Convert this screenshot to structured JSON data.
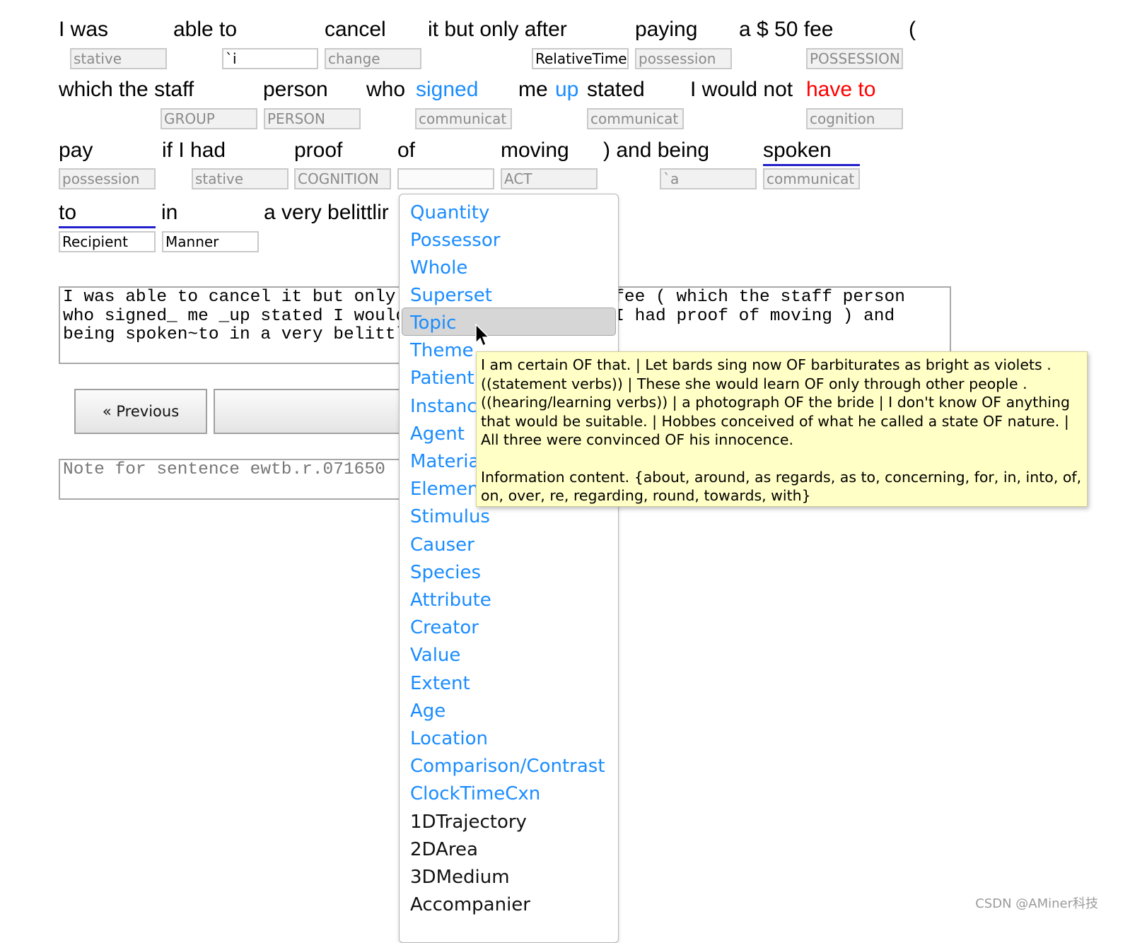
{
  "tokens": [
    {
      "text": "I was",
      "tag": "stative"
    },
    {
      "text": "able to",
      "tag": "`i"
    },
    {
      "text": "cancel",
      "tag": "change"
    },
    {
      "text": "it but only after",
      "tag": "RelativeTime"
    },
    {
      "text": "paying",
      "tag": "possession"
    },
    {
      "text": "a $ 50 fee",
      "tag": "POSSESSION"
    },
    {
      "text": "(",
      "tag": ""
    },
    {
      "text": "which the staff",
      "tag": ""
    },
    {
      "text": "person",
      "tag": "GROUP"
    },
    {
      "text": "",
      "tag": "PERSON"
    },
    {
      "text": "who",
      "tag": ""
    },
    {
      "text": "signed",
      "tag": "communicat"
    },
    {
      "text": "me",
      "tag": ""
    },
    {
      "text": "up",
      "tag": ""
    },
    {
      "text": "stated",
      "tag": "communicat"
    },
    {
      "text": "I would not",
      "tag": ""
    },
    {
      "text": "have to",
      "tag": "cognition"
    },
    {
      "text": "pay",
      "tag": "possession"
    },
    {
      "text": "if I had",
      "tag": "stative"
    },
    {
      "text": "proof",
      "tag": "COGNITION"
    },
    {
      "text": "of",
      "tag": ""
    },
    {
      "text": "moving",
      "tag": "ACT"
    },
    {
      "text": ") and being",
      "tag": "`a"
    },
    {
      "text": "spoken",
      "tag": "communicat"
    },
    {
      "text": "to",
      "tag": "Recipient"
    },
    {
      "text": "in",
      "tag": "Manner"
    },
    {
      "text": "a very belittlir",
      "tag": ""
    }
  ],
  "sentence_text": "I was able to cancel it but only after paying a $ 50 fee ( which the staff person\nwho signed_ me _up stated I would not have to pay if I had proof of moving ) and\nbeing spoken~to in a very belittling",
  "previous_button": "« Previous",
  "note_placeholder": "Note for sentence ewtb.r.071650",
  "dropdown": {
    "options": [
      "Quantity",
      "Possessor",
      "Whole",
      "Superset",
      "Topic",
      "Theme",
      "Patient",
      "Instance",
      "Agent",
      "Material",
      "Element",
      "Stimulus",
      "Causer",
      "Species",
      "Attribute",
      "Creator",
      "Value",
      "Extent",
      "Age",
      "Location",
      "Comparison/Contrast",
      "ClockTimeCxn",
      "1DTrajectory",
      "2DArea",
      "3DMedium",
      "Accompanier"
    ],
    "highlighted": "Topic"
  },
  "tooltip": {
    "examples": "I am certain OF that. | Let bards sing now OF barbiturates as bright as violets . ((statement verbs)) | These she would learn OF only through other people . ((hearing/learning verbs)) | a photograph OF the bride | I don't know OF anything that would be suitable. | Hobbes conceived of what he called a state OF nature. | All three were convinced OF his innocence.",
    "definition": "Information content. {about, around, as regards, as to, concerning, for, in, into, of, on, over, re, regarding, round, towards, with}"
  },
  "watermark": "CSDN @AMiner科技",
  "colors": {
    "link": "#1a8cff",
    "multiword": "#ff0000",
    "underline": "#2222cc",
    "tooltip_bg": "#ffffc6"
  }
}
